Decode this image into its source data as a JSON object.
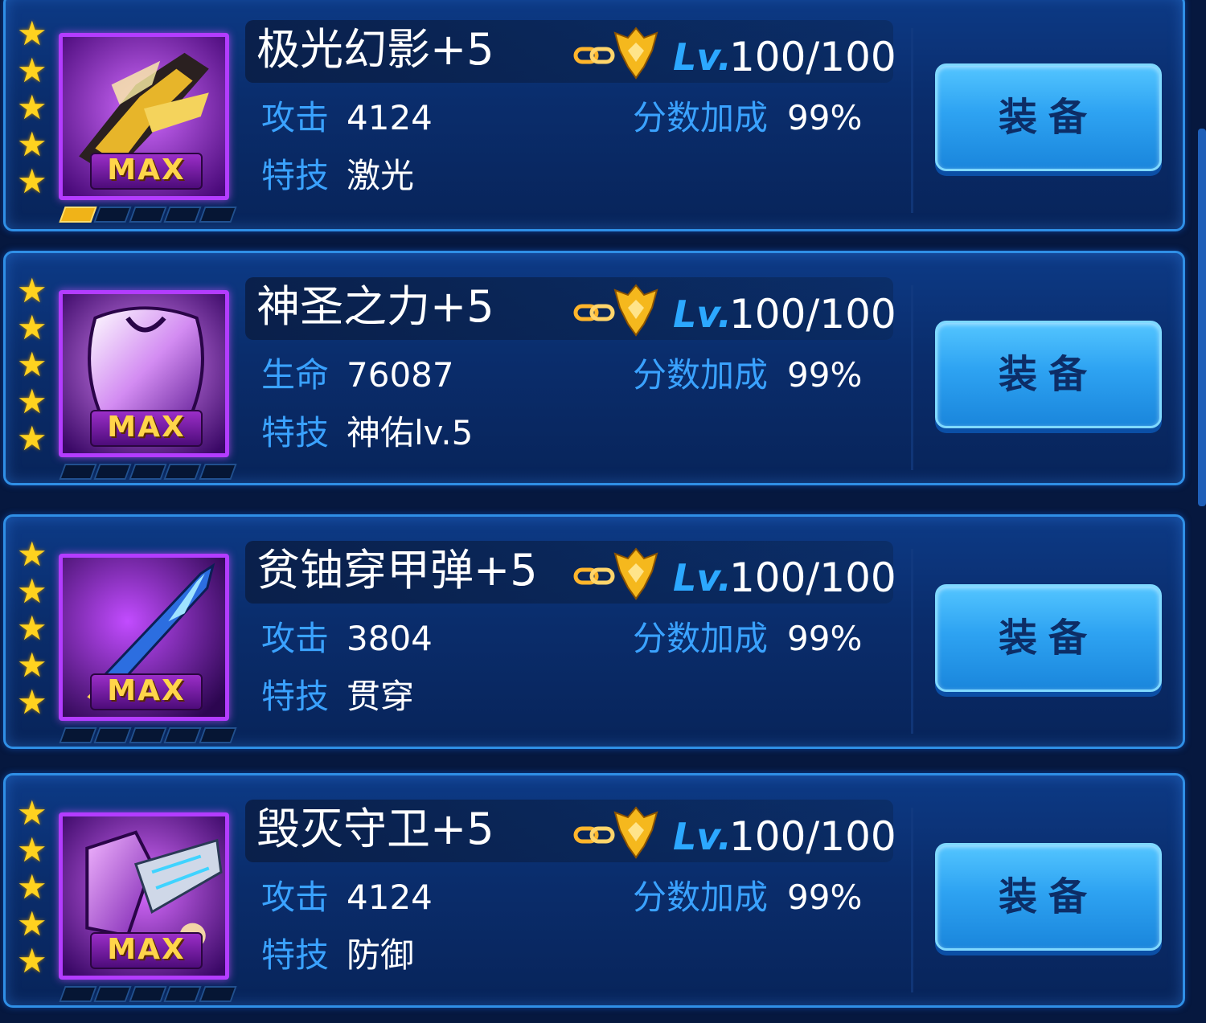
{
  "items": [
    {
      "name": "极光幻影+5",
      "max_badge": "MAX",
      "level_prefix": "Lv.",
      "level": "100/100",
      "stat_label": "攻击",
      "stat_value": "4124",
      "skill_label": "特技",
      "skill_value": "激光",
      "bonus_label": "分数加成",
      "bonus_value": "99%",
      "equip_label": "装备",
      "stars": 5,
      "slots_filled": 1,
      "icon": "golden-fighter-jet-icon"
    },
    {
      "name": "神圣之力+5",
      "max_badge": "MAX",
      "level_prefix": "Lv.",
      "level": "100/100",
      "stat_label": "生命",
      "stat_value": "76087",
      "skill_label": "特技",
      "skill_value": "神佑lv.5",
      "bonus_label": "分数加成",
      "bonus_value": "99%",
      "equip_label": "装备",
      "stars": 5,
      "slots_filled": 0,
      "icon": "purple-armor-icon"
    },
    {
      "name": "贫铀穿甲弹+5",
      "max_badge": "MAX",
      "level_prefix": "Lv.",
      "level": "100/100",
      "stat_label": "攻击",
      "stat_value": "3804",
      "skill_label": "特技",
      "skill_value": "贯穿",
      "bonus_label": "分数加成",
      "bonus_value": "99%",
      "equip_label": "装备",
      "stars": 5,
      "slots_filled": 0,
      "icon": "missile-icon"
    },
    {
      "name": "毁灭守卫+5",
      "max_badge": "MAX",
      "level_prefix": "Lv.",
      "level": "100/100",
      "stat_label": "攻击",
      "stat_value": "4124",
      "skill_label": "特技",
      "skill_value": "防御",
      "bonus_label": "分数加成",
      "bonus_value": "99%",
      "equip_label": "装备",
      "stars": 5,
      "slots_filled": 0,
      "icon": "shield-drone-icon"
    }
  ],
  "colors": {
    "background": "#06183f",
    "card_border": "#2f8fe6",
    "label_blue": "#3aa2ff",
    "level_blue": "#2ca8ff",
    "star_gold": "#ffd21f",
    "frame_purple": "#b33cff",
    "button_blue": "#2ea3f2"
  }
}
